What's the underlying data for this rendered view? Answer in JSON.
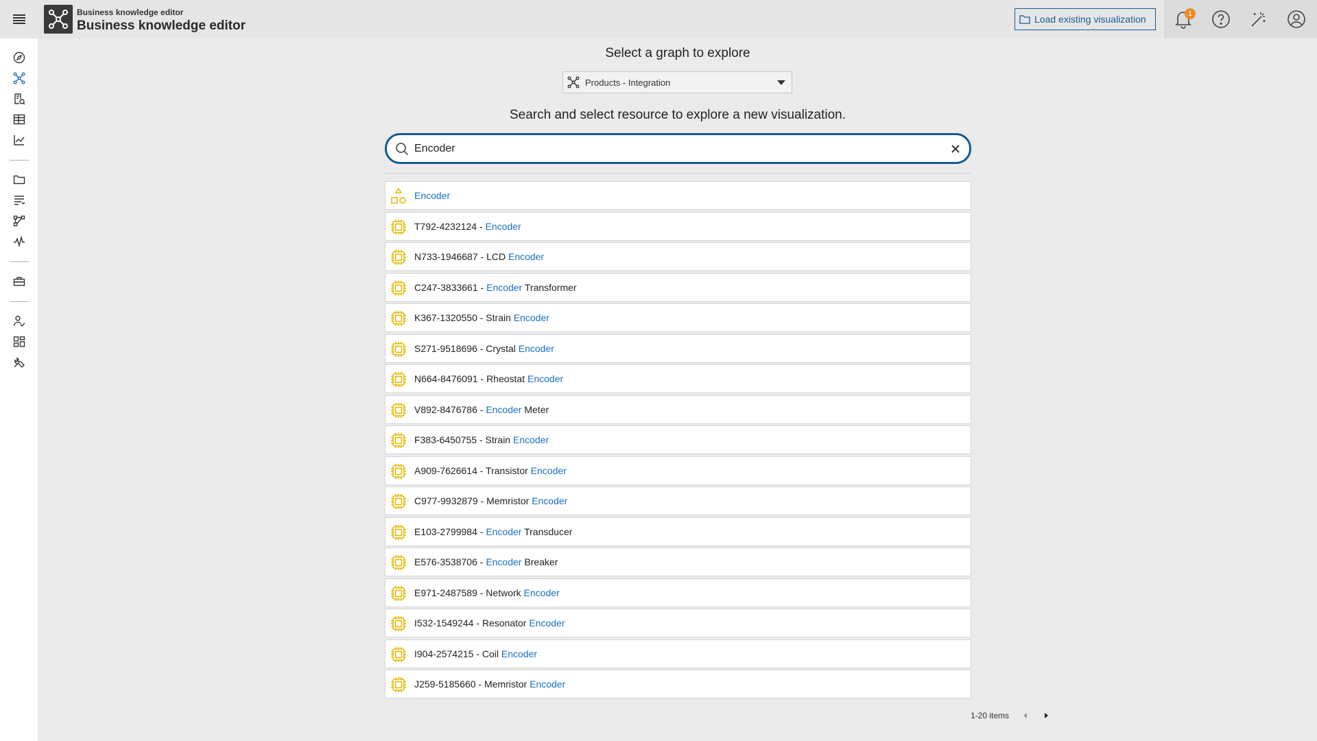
{
  "header": {
    "app_subtitle": "Business knowledge editor",
    "app_title": "Business knowledge editor",
    "load_button": "Load existing visualization",
    "notification_count": "1"
  },
  "sidebar": {
    "items": [
      "compass-icon",
      "graph-icon",
      "database-search-icon",
      "table-icon",
      "chart-line-icon",
      "folder-icon",
      "list-filter-icon",
      "workflow-icon",
      "activity-icon",
      "toolbox-icon",
      "user-check-icon",
      "dashboard-icon",
      "tools-icon"
    ]
  },
  "main": {
    "select_title": "Select a graph to explore",
    "graph_select_value": "Products - Integration",
    "search_title": "Search and select resource to explore a new visualization.",
    "search_value": "Encoder"
  },
  "results": [
    {
      "pre": "",
      "hl": "Encoder",
      "post": "",
      "icon": "class"
    },
    {
      "pre": "T792-4232124 - ",
      "hl": "Encoder",
      "post": "",
      "icon": "chip"
    },
    {
      "pre": "N733-1946687 - LCD ",
      "hl": "Encoder",
      "post": "",
      "icon": "chip"
    },
    {
      "pre": "C247-3833661 - ",
      "hl": "Encoder",
      "post": " Transformer",
      "icon": "chip"
    },
    {
      "pre": "K367-1320550 - Strain ",
      "hl": "Encoder",
      "post": "",
      "icon": "chip"
    },
    {
      "pre": "S271-9518696 - Crystal ",
      "hl": "Encoder",
      "post": "",
      "icon": "chip"
    },
    {
      "pre": "N664-8476091 - Rheostat ",
      "hl": "Encoder",
      "post": "",
      "icon": "chip"
    },
    {
      "pre": "V892-8476786 - ",
      "hl": "Encoder",
      "post": " Meter",
      "icon": "chip"
    },
    {
      "pre": "F383-6450755 - Strain ",
      "hl": "Encoder",
      "post": "",
      "icon": "chip"
    },
    {
      "pre": "A909-7626614 - Transistor ",
      "hl": "Encoder",
      "post": "",
      "icon": "chip"
    },
    {
      "pre": "C977-9932879 - Memristor ",
      "hl": "Encoder",
      "post": "",
      "icon": "chip"
    },
    {
      "pre": "E103-2799984 - ",
      "hl": "Encoder",
      "post": " Transducer",
      "icon": "chip"
    },
    {
      "pre": "E576-3538706 - ",
      "hl": "Encoder",
      "post": " Breaker",
      "icon": "chip"
    },
    {
      "pre": "E971-2487589 - Network ",
      "hl": "Encoder",
      "post": "",
      "icon": "chip"
    },
    {
      "pre": "I532-1549244 - Resonator ",
      "hl": "Encoder",
      "post": "",
      "icon": "chip"
    },
    {
      "pre": "I904-2574215 - Coil ",
      "hl": "Encoder",
      "post": "",
      "icon": "chip"
    },
    {
      "pre": "J259-5185660 - Memristor ",
      "hl": "Encoder",
      "post": "",
      "icon": "chip"
    }
  ],
  "pager": {
    "label": "1-20 items"
  },
  "colors": {
    "accent": "#135c8c",
    "highlight": "#1a6fbf",
    "chip_icon": "#e3b800",
    "badge": "#f08a24"
  }
}
